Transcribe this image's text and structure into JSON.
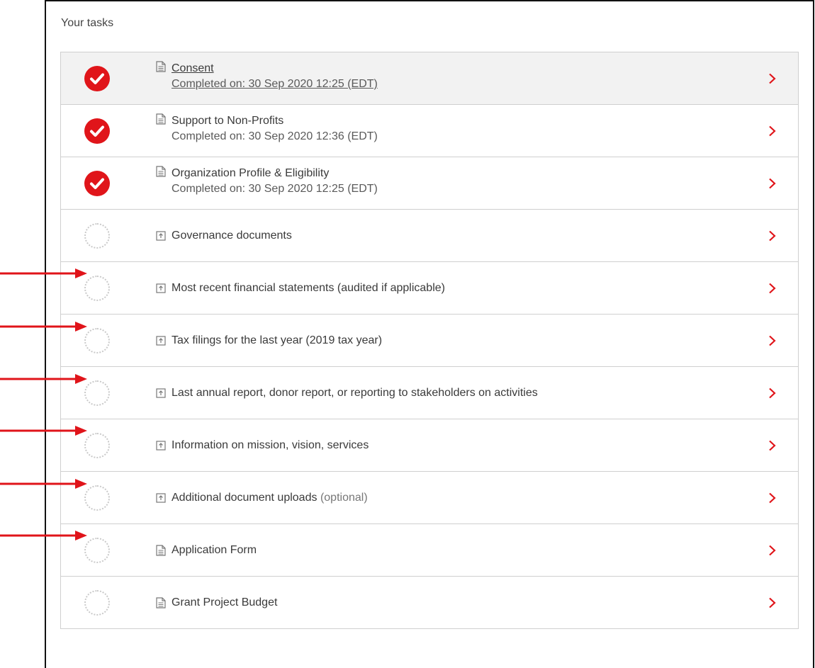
{
  "panel": {
    "title": "Your tasks"
  },
  "colors": {
    "accent": "#e0151a",
    "pending_ring": "#c9c9c9",
    "arrow": "#e0141a"
  },
  "tasks": [
    {
      "title": "Consent",
      "subtitle": "Completed on: 30 Sep 2020 12:25 (EDT)",
      "status": "completed",
      "icon": "document-icon",
      "underlined": true
    },
    {
      "title": "Support to Non-Profits",
      "subtitle": "Completed on: 30 Sep 2020 12:36 (EDT)",
      "status": "completed",
      "icon": "document-icon"
    },
    {
      "title": "Organization Profile & Eligibility",
      "subtitle": "Completed on: 30 Sep 2020 12:25 (EDT)",
      "status": "completed",
      "icon": "document-icon"
    },
    {
      "title": "Governance documents",
      "status": "pending",
      "icon": "upload-icon"
    },
    {
      "title": "Most recent financial statements (audited if applicable)",
      "status": "pending",
      "icon": "upload-icon"
    },
    {
      "title": "Tax filings for the last year (2019 tax year)",
      "status": "pending",
      "icon": "upload-icon"
    },
    {
      "title": "Last annual report, donor report, or reporting to stakeholders on activities",
      "status": "pending",
      "icon": "upload-icon"
    },
    {
      "title": "Information on mission, vision, services",
      "status": "pending",
      "icon": "upload-icon"
    },
    {
      "title": "Additional document uploads",
      "optional_label": "(optional)",
      "status": "pending",
      "icon": "upload-icon"
    },
    {
      "title": "Application Form",
      "status": "pending",
      "icon": "document-icon"
    },
    {
      "title": "Grant Project Budget",
      "status": "pending",
      "icon": "document-icon"
    }
  ]
}
